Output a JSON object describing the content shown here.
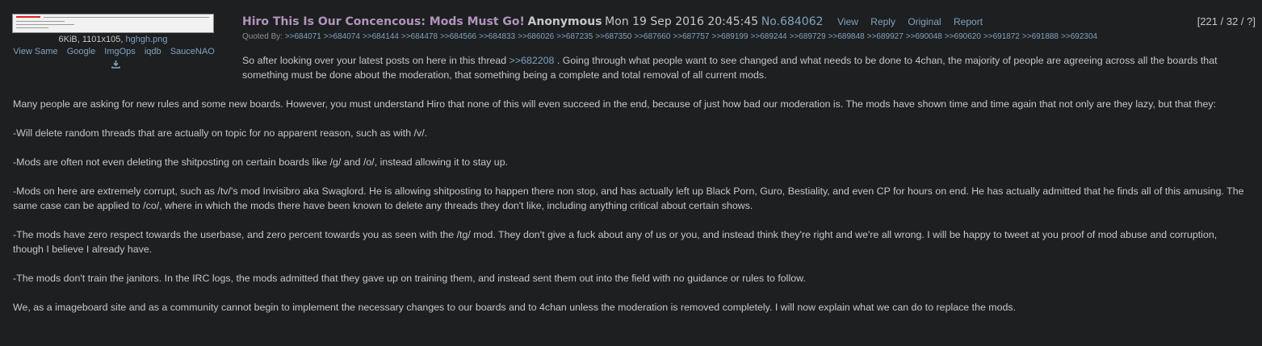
{
  "file": {
    "size_dims": "6KiB, 1101x105,",
    "name": "hghgh.png",
    "links": [
      "View Same",
      "Google",
      "ImgOps",
      "iqdb",
      "SauceNAO"
    ],
    "download_icon": "download-icon"
  },
  "post": {
    "subject": "Hiro This Is Our Concencous: Mods Must Go!",
    "author": "Anonymous",
    "date": "Mon 19 Sep 2016 20:45:45",
    "number": "No.684062",
    "actions": [
      "View",
      "Reply",
      "Original",
      "Report"
    ],
    "counts": "[221 / 32 / ?]",
    "quoted_by_label": "Quoted By:",
    "quoted_by": [
      ">>684071",
      ">>684074",
      ">>684144",
      ">>684478",
      ">>684566",
      ">>684833",
      ">>686026",
      ">>687235",
      ">>687350",
      ">>687660",
      ">>687757",
      ">>689199",
      ">>689244",
      ">>689729",
      ">>689848",
      ">>689927",
      ">>690048",
      ">>690620",
      ">>691872",
      ">>691888",
      ">>692304"
    ],
    "intro_before_link": "So after looking over your latest posts on here in this thread ",
    "intro_link": ">>682208",
    "intro_after_link": " . Going through what people want to see changed and what needs to be done to 4chan, the majority of people are agreeing across all the boards that something must be done about the moderation, that something being a complete and total removal of all current mods.",
    "paragraphs": [
      "Many people are asking for new rules and some new boards. However, you must understand Hiro that none of this will even succeed in the end, because of just how bad our moderation is. The mods have shown time and time again that not only are they lazy, but that they:",
      "-Will delete random threads that are actually on topic for no apparent reason, such as with /v/.",
      "-Mods are often not even deleting the shitposting on certain boards like /g/ and /o/, instead allowing it to stay up.",
      "-Mods on here are extremely corrupt, such as /tv/'s mod Invisibro aka Swaglord. He is allowing shitposting to happen there non stop, and has actually left up Black Porn, Guro, Bestiality, and even CP for hours on end. He has actually admitted that he finds all of this amusing. The same case can be applied to /co/, where in which the mods there have been known to delete any threads they don't like, including anything critical about certain shows.",
      "-The mods have zero respect towards the userbase, and zero percent towards you as seen with the /tg/ mod. They don't give a fuck about any of us or you, and instead think they're right and we're all wrong. I will be happy to tweet at you proof of mod abuse and corruption, though I believe I already have.",
      "-The mods don't train the janitors. In the IRC logs, the mods admitted that they gave up on training them, and instead sent them out into the field with no guidance or rules to follow.",
      "We, as a imageboard site and as a community cannot begin to implement the necessary changes to our boards and to 4chan unless the moderation is removed completely. I will now explain what we can do to replace the mods."
    ]
  }
}
